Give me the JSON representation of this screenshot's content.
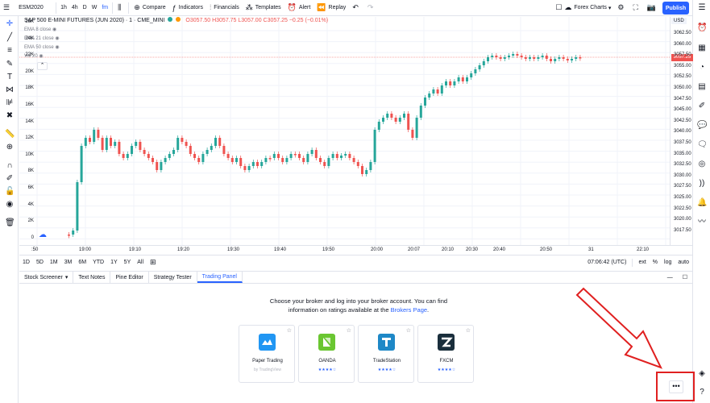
{
  "topbar": {
    "symbol": "ESM2020",
    "intervals": [
      "1h",
      "4h",
      "D",
      "W",
      "fm"
    ],
    "compare": "Compare",
    "indicators": "Indicators",
    "financials": "Financials",
    "templates": "Templates",
    "alert": "Alert",
    "replay": "Replay",
    "layout_name": "Forex Charts",
    "publish": "Publish"
  },
  "legend": {
    "title": "S&P 500 E-MINI FUTURES (JUN 2020) · 1 · CME_MINI",
    "ohlc": "O3057.50 H3057.75 L3057.00 C3057.25 −0.25 (−0.01%)",
    "indicators": [
      "EMA 8 close",
      "EMA 21 close",
      "EMA 50 close",
      "Vol 20"
    ]
  },
  "price_axis": {
    "currency": "USD",
    "labels": [
      "3062.50",
      "3060.00",
      "3057.50",
      "3055.00",
      "3052.50",
      "3050.00",
      "3047.50",
      "3045.00",
      "3042.50",
      "3040.00",
      "3037.50",
      "3035.00",
      "3032.50",
      "3030.00",
      "3027.50",
      "3025.00",
      "3022.50",
      "3020.00",
      "3017.50"
    ],
    "current": "3057.25"
  },
  "volume_axis": [
    "26K",
    "24K",
    "22K",
    "20K",
    "18K",
    "16K",
    "14K",
    "12K",
    "10K",
    "8K",
    "6K",
    "4K",
    "2K",
    "0"
  ],
  "time_axis": [
    ":50",
    "19:00",
    "19:10",
    "19:20",
    "19:30",
    "19:40",
    "19:50",
    "20:00",
    "20:07",
    "20:10",
    "20:30",
    "20:40",
    "20:50",
    "31",
    "22:10"
  ],
  "timeframes": [
    "1D",
    "5D",
    "1M",
    "3M",
    "6M",
    "YTD",
    "1Y",
    "5Y",
    "All"
  ],
  "clock": "07:06:42 (UTC)",
  "axis_opts": [
    "ext",
    "%",
    "log",
    "auto"
  ],
  "panel_tabs": [
    "Stock Screener",
    "Text Notes",
    "Pine Editor",
    "Strategy Tester",
    "Trading Panel"
  ],
  "panel_active": "Trading Panel",
  "message": {
    "line1": "Choose your broker and log into your broker account. You can find",
    "line2": "information on ratings available at the ",
    "link": "Brokers Page",
    "end": "."
  },
  "brokers": [
    {
      "name": "Paper Trading",
      "sub": "by TradingView",
      "color": "#2196f3"
    },
    {
      "name": "OANDA",
      "stars": "★★★★☆",
      "color": "#6ac631"
    },
    {
      "name": "TradeStation",
      "stars": "★★★★☆",
      "color": "#1e88c7"
    },
    {
      "name": "FXCM",
      "stars": "★★★★☆",
      "color": "#1a2e3c"
    }
  ],
  "more_button": "•••",
  "colors": {
    "up": "#26a69a",
    "down": "#ef5350",
    "accent": "#2962ff"
  }
}
